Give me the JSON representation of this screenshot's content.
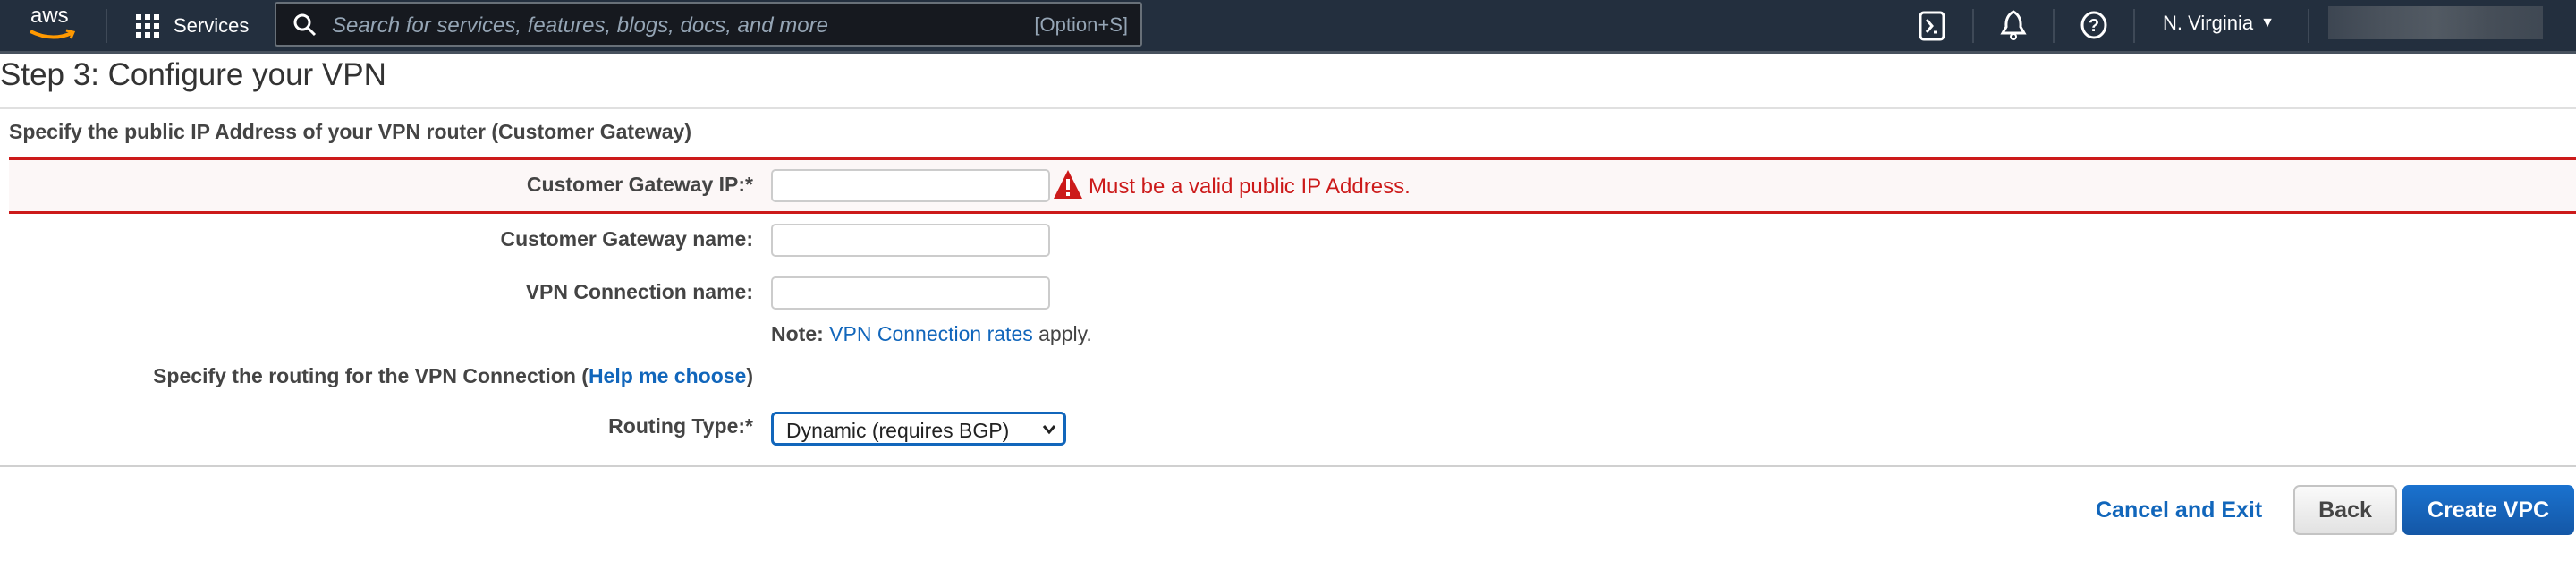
{
  "nav": {
    "logo_text": "aws",
    "services_label": "Services",
    "search_placeholder": "Search for services, features, blogs, docs, and more",
    "search_shortcut": "[Option+S]",
    "region": "N. Virginia",
    "icons": [
      "cloudshell-icon",
      "bell-icon",
      "help-icon"
    ]
  },
  "page": {
    "title": "Step 3: Configure your VPN",
    "section_header": "Specify the public IP Address of your VPN router (Customer Gateway)",
    "fields": {
      "cgw_ip_label": "Customer Gateway IP:*",
      "cgw_ip_value": "",
      "cgw_ip_error": "Must be a valid public IP Address.",
      "cgw_name_label": "Customer Gateway name:",
      "cgw_name_value": "",
      "vpn_name_label": "VPN Connection name:",
      "vpn_name_value": ""
    },
    "note": {
      "label": "Note:",
      "link": "VPN Connection rates",
      "suffix": "apply."
    },
    "routing": {
      "header_prefix": "Specify the routing for the VPN Connection (",
      "help_link": "Help me choose",
      "header_suffix": ")",
      "type_label": "Routing Type:*",
      "type_value": "Dynamic (requires BGP)"
    }
  },
  "footer": {
    "cancel": "Cancel and Exit",
    "back": "Back",
    "create": "Create VPC"
  },
  "colors": {
    "error": "#d13212",
    "link": "#1166bb",
    "primary": "#1166bb",
    "nav_bg": "#232f3e"
  }
}
